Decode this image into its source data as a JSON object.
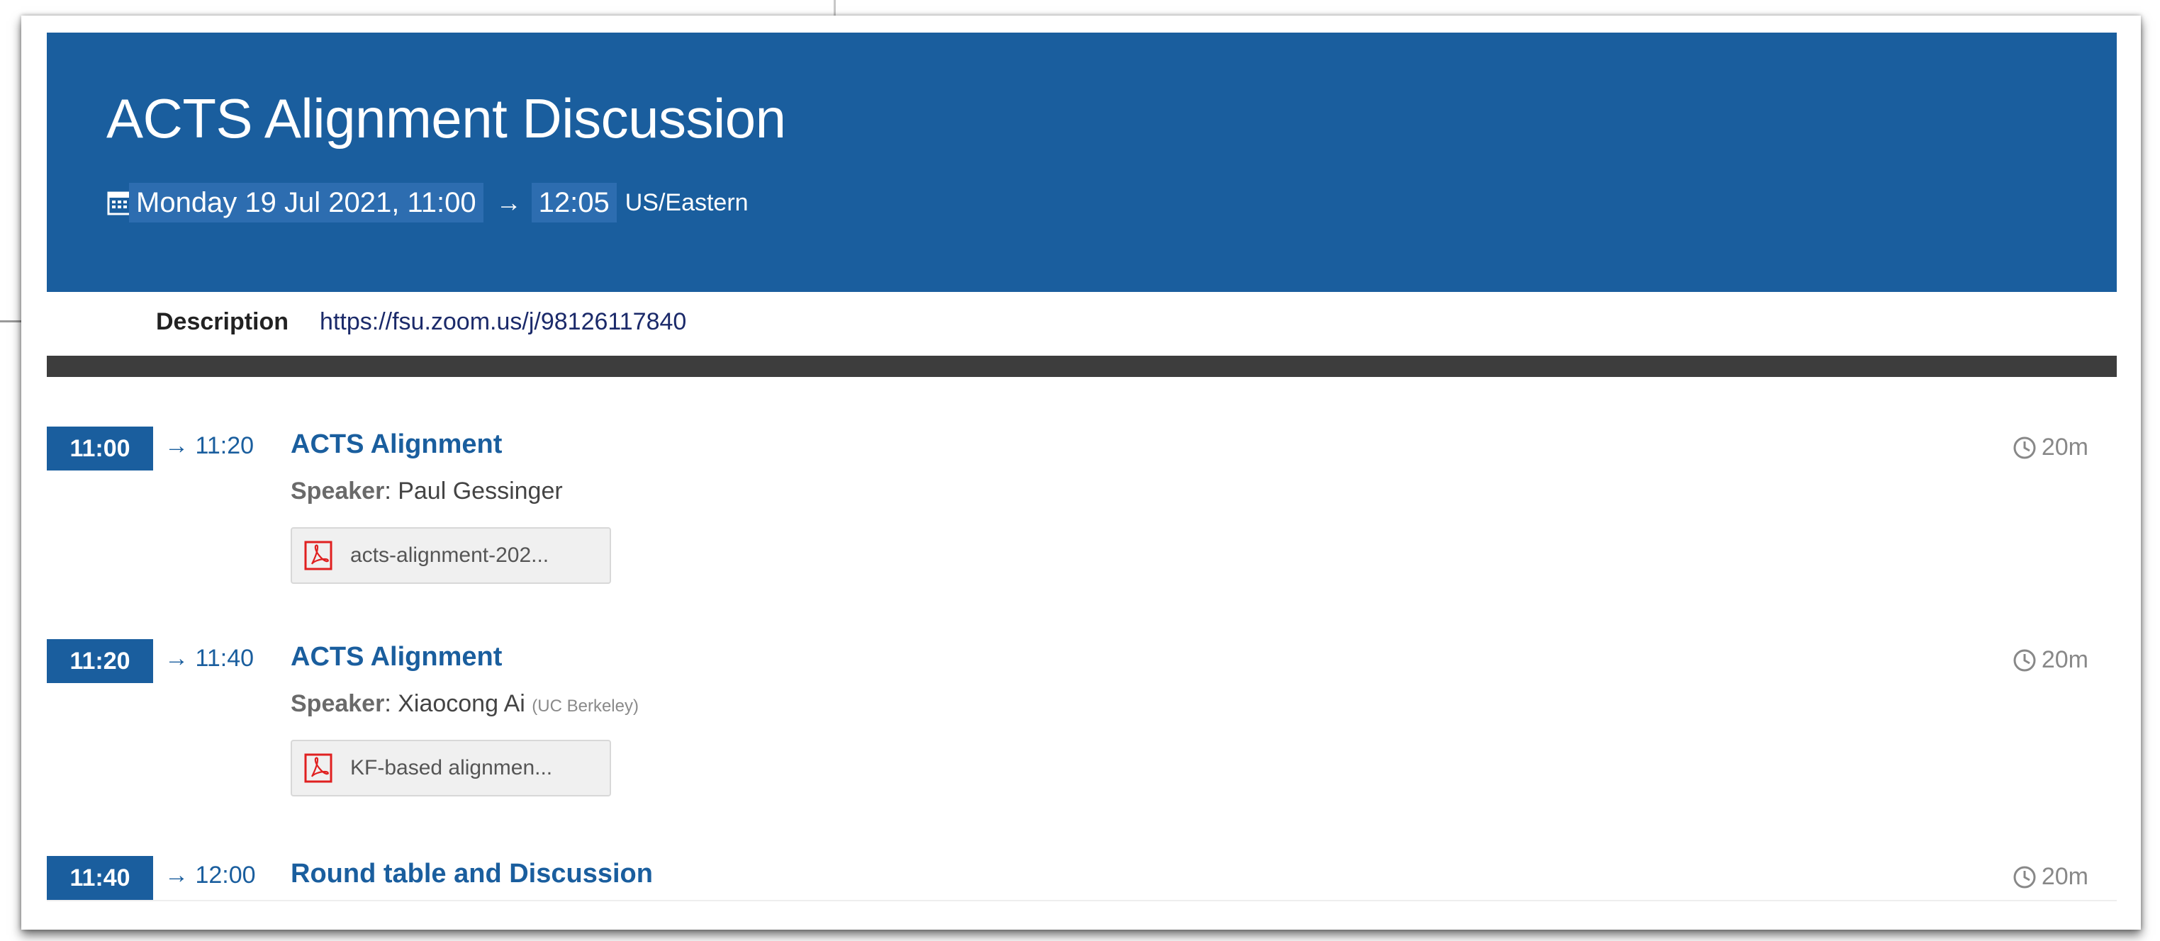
{
  "event": {
    "title": "ACTS Alignment Discussion",
    "date_start": "Monday 19 Jul 2021, 11:00",
    "arrow": "→",
    "time_end": "12:05",
    "timezone": "US/Eastern",
    "description_label": "Description",
    "description_link": "https://fsu.zoom.us/j/98126117840"
  },
  "colors": {
    "header_bg": "#1a5e9e",
    "divider": "#3d3d3d",
    "accent": "#1a5e9e",
    "pdf_red": "#e02020"
  },
  "icons": {
    "calendar": "calendar-icon",
    "pdf": "pdf-file-icon",
    "clock": "clock-icon"
  },
  "entries": [
    {
      "start": "11:00",
      "end": "→ 11:20",
      "title": "ACTS Alignment",
      "speaker_label": "Speaker",
      "speaker_name": ": Paul Gessinger",
      "affiliation": "",
      "attachment": "acts-alignment-202...",
      "duration": "20m"
    },
    {
      "start": "11:20",
      "end": "→ 11:40",
      "title": "ACTS Alignment",
      "speaker_label": "Speaker",
      "speaker_name": ": Xiaocong Ai",
      "affiliation": "(UC Berkeley)",
      "attachment": "KF-based alignmen...",
      "duration": "20m"
    },
    {
      "start": "11:40",
      "end": "→ 12:00",
      "title": "Round table and Discussion",
      "duration": "20m"
    }
  ]
}
